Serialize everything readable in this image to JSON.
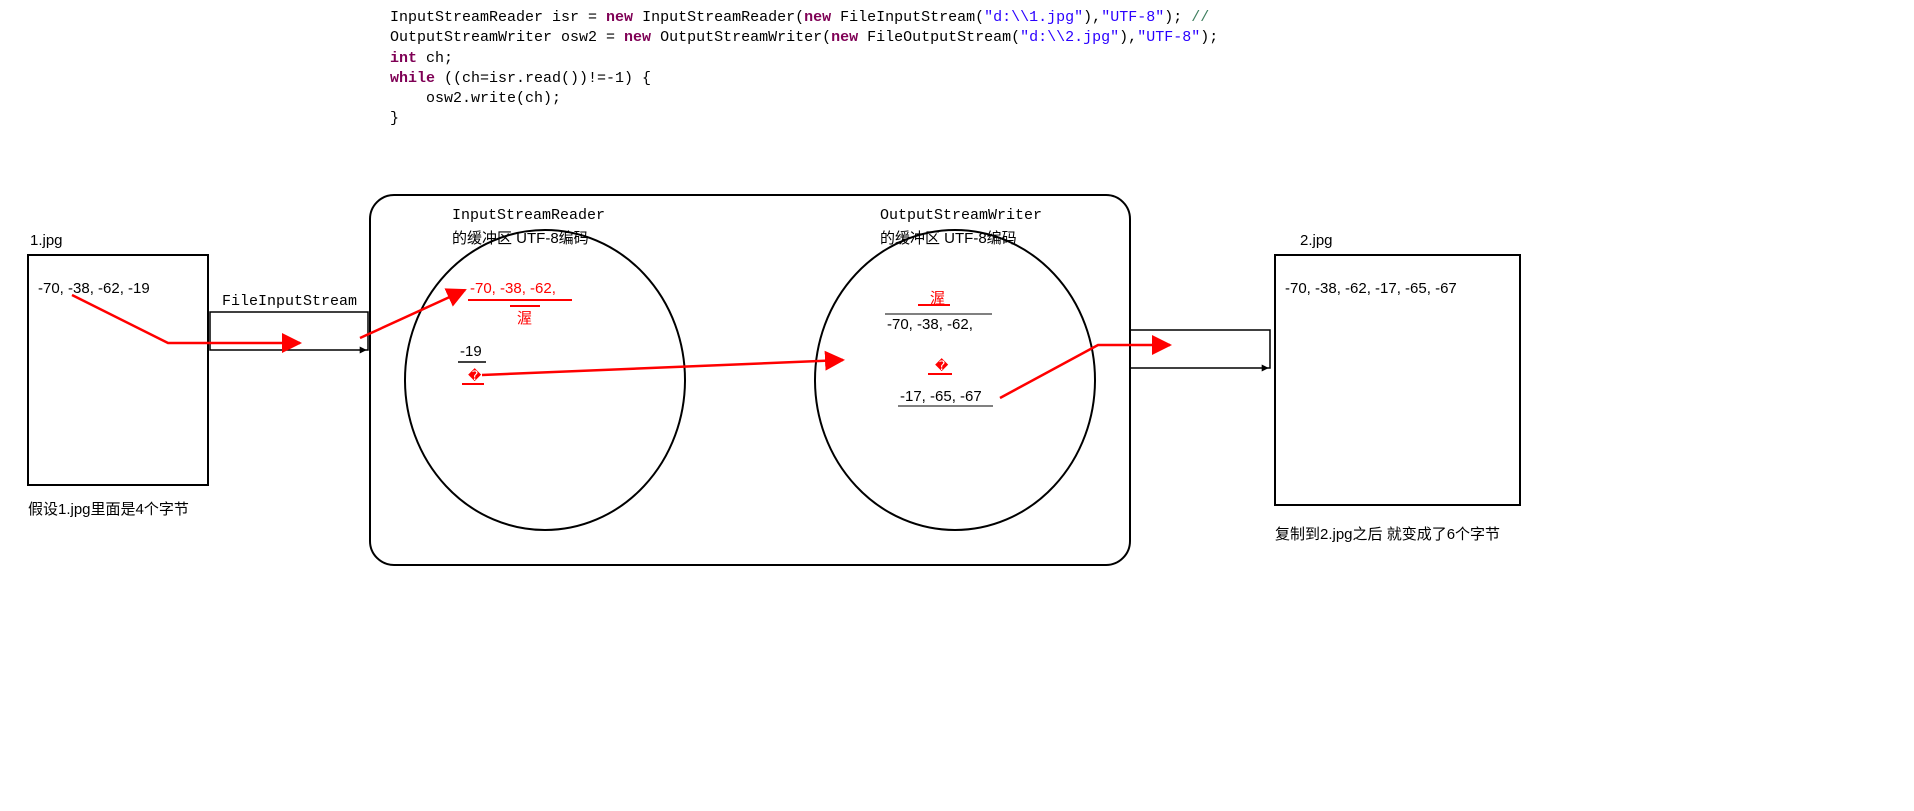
{
  "code": {
    "l1a": "InputStreamReader isr = ",
    "l1b": "new",
    "l1c": " InputStreamReader(",
    "l1d": "new",
    "l1e": " FileInputStream(",
    "l1f": "\"d:\\\\1.jpg\"",
    "l1g": "),",
    "l1h": "\"UTF-8\"",
    "l1i": "); ",
    "l1j": "//",
    "l2a": "OutputStreamWriter osw2 = ",
    "l2b": "new",
    "l2c": " OutputStreamWriter(",
    "l2d": "new",
    "l2e": " FileOutputStream(",
    "l2f": "\"d:\\\\2.jpg\"",
    "l2g": "),",
    "l2h": "\"UTF-8\"",
    "l2i": ");",
    "l3a": "int",
    "l3b": " ch;",
    "l4a": "while",
    "l4b": " ((ch=isr.read())!=-1) {",
    "l5": "    osw2.write(ch);",
    "l6": "}"
  },
  "left": {
    "title": "1.jpg",
    "bytes": "-70, -38, -62, -19",
    "caption": "假设1.jpg里面是4个字节"
  },
  "right": {
    "title": "2.jpg",
    "bytes": "-70, -38, -62,   -17, -65, -67",
    "caption": "复制到2.jpg之后 就变成了6个字节"
  },
  "fis_label": "FileInputStream",
  "isr": {
    "title1": "InputStreamReader",
    "title2": "的缓冲区 UTF-8编码",
    "bytes1": "-70, -38, -62,",
    "char1": "渥",
    "bytes2": "-19",
    "char2": "�"
  },
  "osw": {
    "title1": "OutputStreamWriter",
    "title2": "的缓冲区 UTF-8编码",
    "char1": "渥",
    "bytes1": "-70, -38, -62,",
    "char2": "�",
    "bytes2": "-17, -65, -67"
  }
}
